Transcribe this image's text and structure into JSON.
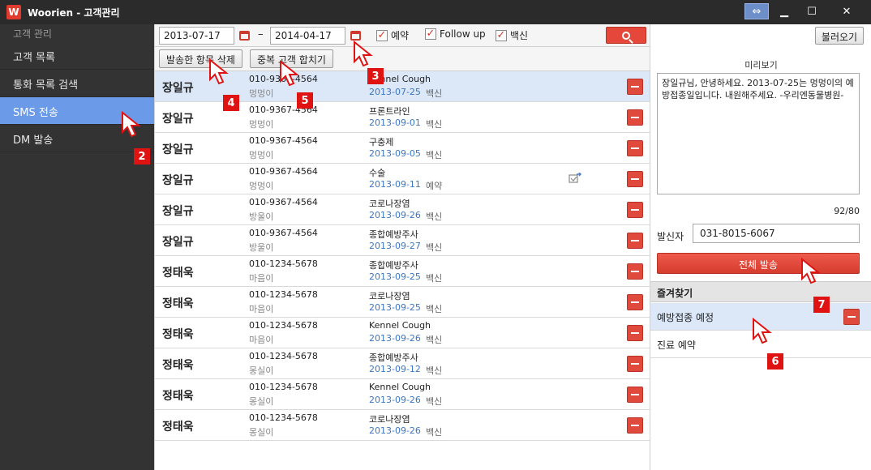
{
  "window": {
    "app_title": "Woorien - 고객관리",
    "logo_letter": "W"
  },
  "sidebar": {
    "header": "고객 관리",
    "items": [
      "고객 목록",
      "통화 목록 검색",
      "SMS 전송",
      "DM 발송"
    ],
    "active_index": 2
  },
  "filters": {
    "start_date": "2013-07-17",
    "separator": "–",
    "end_date": "2014-04-17",
    "checkboxes": [
      {
        "label": "예약",
        "checked": true
      },
      {
        "label": "Follow up",
        "checked": true
      },
      {
        "label": "백신",
        "checked": true
      }
    ]
  },
  "actions": {
    "delete_sent": "발송한 항목 삭제",
    "merge_duplicates": "중복 고객 합치기"
  },
  "rows": [
    {
      "name": "장일규",
      "phone": "010-9367-4564",
      "pet": "멍멍이",
      "title": "Kennel Cough",
      "date": "2013-07-25",
      "type": "백신",
      "selected": true
    },
    {
      "name": "장일규",
      "phone": "010-9367-4564",
      "pet": "멍멍이",
      "title": "프론트라인",
      "date": "2013-09-01",
      "type": "백신"
    },
    {
      "name": "장일규",
      "phone": "010-9367-4564",
      "pet": "멍멍이",
      "title": "구충제",
      "date": "2013-09-05",
      "type": "백신"
    },
    {
      "name": "장일규",
      "phone": "010-9367-4564",
      "pet": "멍멍이",
      "title": "수술",
      "date": "2013-09-11",
      "type": "예약",
      "has_send_icon": true
    },
    {
      "name": "장일규",
      "phone": "010-9367-4564",
      "pet": "방울이",
      "title": "코로나장염",
      "date": "2013-09-26",
      "type": "백신"
    },
    {
      "name": "장일규",
      "phone": "010-9367-4564",
      "pet": "방울이",
      "title": "종합예방주사",
      "date": "2013-09-27",
      "type": "백신"
    },
    {
      "name": "정태욱",
      "phone": "010-1234-5678",
      "pet": "마음이",
      "title": "종합예방주사",
      "date": "2013-09-25",
      "type": "백신"
    },
    {
      "name": "정태욱",
      "phone": "010-1234-5678",
      "pet": "마음이",
      "title": "코로나장염",
      "date": "2013-09-25",
      "type": "백신"
    },
    {
      "name": "정태욱",
      "phone": "010-1234-5678",
      "pet": "마음이",
      "title": "Kennel Cough",
      "date": "2013-09-26",
      "type": "백신"
    },
    {
      "name": "정태욱",
      "phone": "010-1234-5678",
      "pet": "몽실이",
      "title": "종합예방주사",
      "date": "2013-09-12",
      "type": "백신"
    },
    {
      "name": "정태욱",
      "phone": "010-1234-5678",
      "pet": "몽실이",
      "title": "Kennel Cough",
      "date": "2013-09-26",
      "type": "백신"
    },
    {
      "name": "정태욱",
      "phone": "010-1234-5678",
      "pet": "몽실이",
      "title": "코로나장염",
      "date": "2013-09-26",
      "type": "백신"
    }
  ],
  "right_panel": {
    "load_button": "불러오기",
    "preview_label": "미리보기",
    "preview_text": "장일규님, 안녕하세요. 2013-07-25는 멍멍이의 예방접종일입니다. 내원해주세요. -우리엔동물병원-",
    "char_count": "92/80",
    "sender_label": "발신자",
    "sender_value": "031-8015-6067",
    "send_all_button": "전체 발송",
    "favorites_header": "즐겨찾기",
    "favorites": [
      {
        "label": "예방접종 예정",
        "selected": true
      },
      {
        "label": "진료 예약"
      }
    ]
  },
  "annotations": [
    "2",
    "3",
    "4",
    "5",
    "6",
    "7"
  ],
  "colors": {
    "accent_red": "#e04a3c",
    "active_blue": "#6b9ae8",
    "date_blue": "#3b76c4",
    "sidebar_bg": "#333333"
  }
}
